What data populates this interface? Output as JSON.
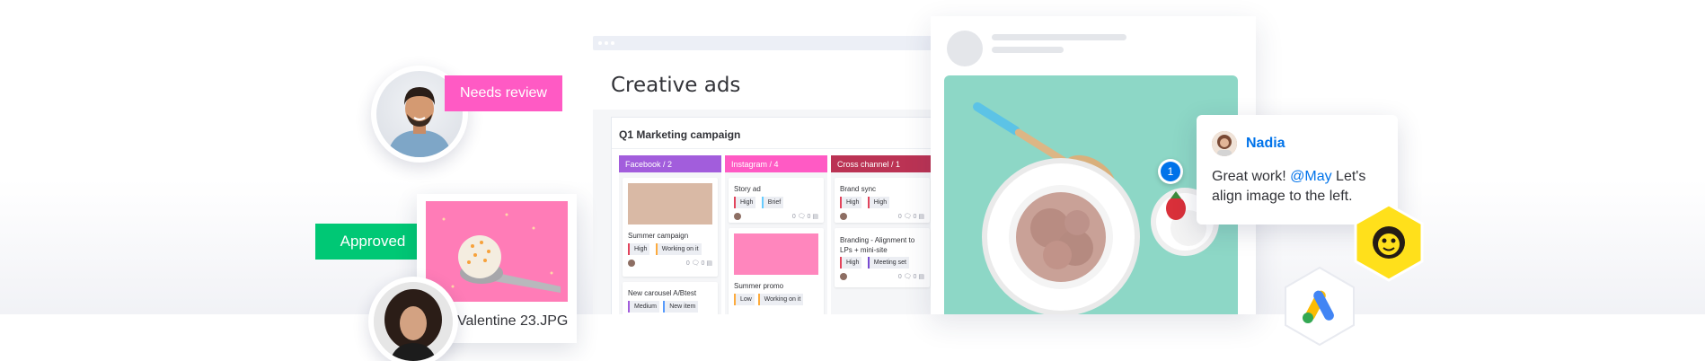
{
  "tags": {
    "needs_review": "Needs review",
    "approved": "Approved"
  },
  "photo_card": {
    "filename": "Valentine 23.JPG"
  },
  "board": {
    "title": "Creative ads",
    "group_title": "Q1 Marketing campaign",
    "columns": [
      {
        "header": "Facebook / 2",
        "color": "#a25ddc",
        "cards": [
          {
            "title": "Summer campaign",
            "has_image": true,
            "pills": [
              {
                "label": "High",
                "color": "#e2445c"
              },
              {
                "label": "Working on it",
                "color": "#fdab3d"
              }
            ],
            "updates": "0",
            "subitems": "0"
          },
          {
            "title": "New carousel A/Btest",
            "has_image": false,
            "pills": [
              {
                "label": "Medium",
                "color": "#a25ddc"
              },
              {
                "label": "New item",
                "color": "#579bfc"
              }
            ],
            "updates": "",
            "subitems": ""
          }
        ]
      },
      {
        "header": "Instagram / 4",
        "color": "#ff5ac4",
        "cards": [
          {
            "title": "Story ad",
            "has_image": false,
            "pills": [
              {
                "label": "High",
                "color": "#e2445c"
              },
              {
                "label": "Brief",
                "color": "#66ccff"
              }
            ],
            "updates": "0",
            "subitems": "0"
          },
          {
            "title": "Summer promo",
            "has_image": true,
            "pills": [
              {
                "label": "Low",
                "color": "#fdab3d"
              },
              {
                "label": "Working on it",
                "color": "#fdab3d"
              }
            ],
            "updates": "",
            "subitems": ""
          }
        ]
      },
      {
        "header": "Cross channel  / 1",
        "color": "#bb3354",
        "cards": [
          {
            "title": "Brand sync",
            "has_image": false,
            "pills": [
              {
                "label": "High",
                "color": "#e2445c"
              },
              {
                "label": "High",
                "color": "#e2445c"
              }
            ],
            "updates": "0",
            "subitems": "0"
          },
          {
            "title": "Branding  - Alignment to LPs + mini-site",
            "has_image": false,
            "pills": [
              {
                "label": "High",
                "color": "#e2445c"
              },
              {
                "label": "Meeting set",
                "color": "#784bd1"
              }
            ],
            "updates": "0",
            "subitems": "0"
          }
        ]
      }
    ]
  },
  "comment": {
    "pin_number": "1",
    "author": "Nadia",
    "text_before": "Great work! ",
    "mention": "@May",
    "text_after": " Let's align image to the left."
  },
  "integrations": [
    {
      "name": "mailchimp-icon",
      "color": "#ffe01b"
    },
    {
      "name": "google-ads-icon",
      "color": "#4285f4"
    }
  ]
}
